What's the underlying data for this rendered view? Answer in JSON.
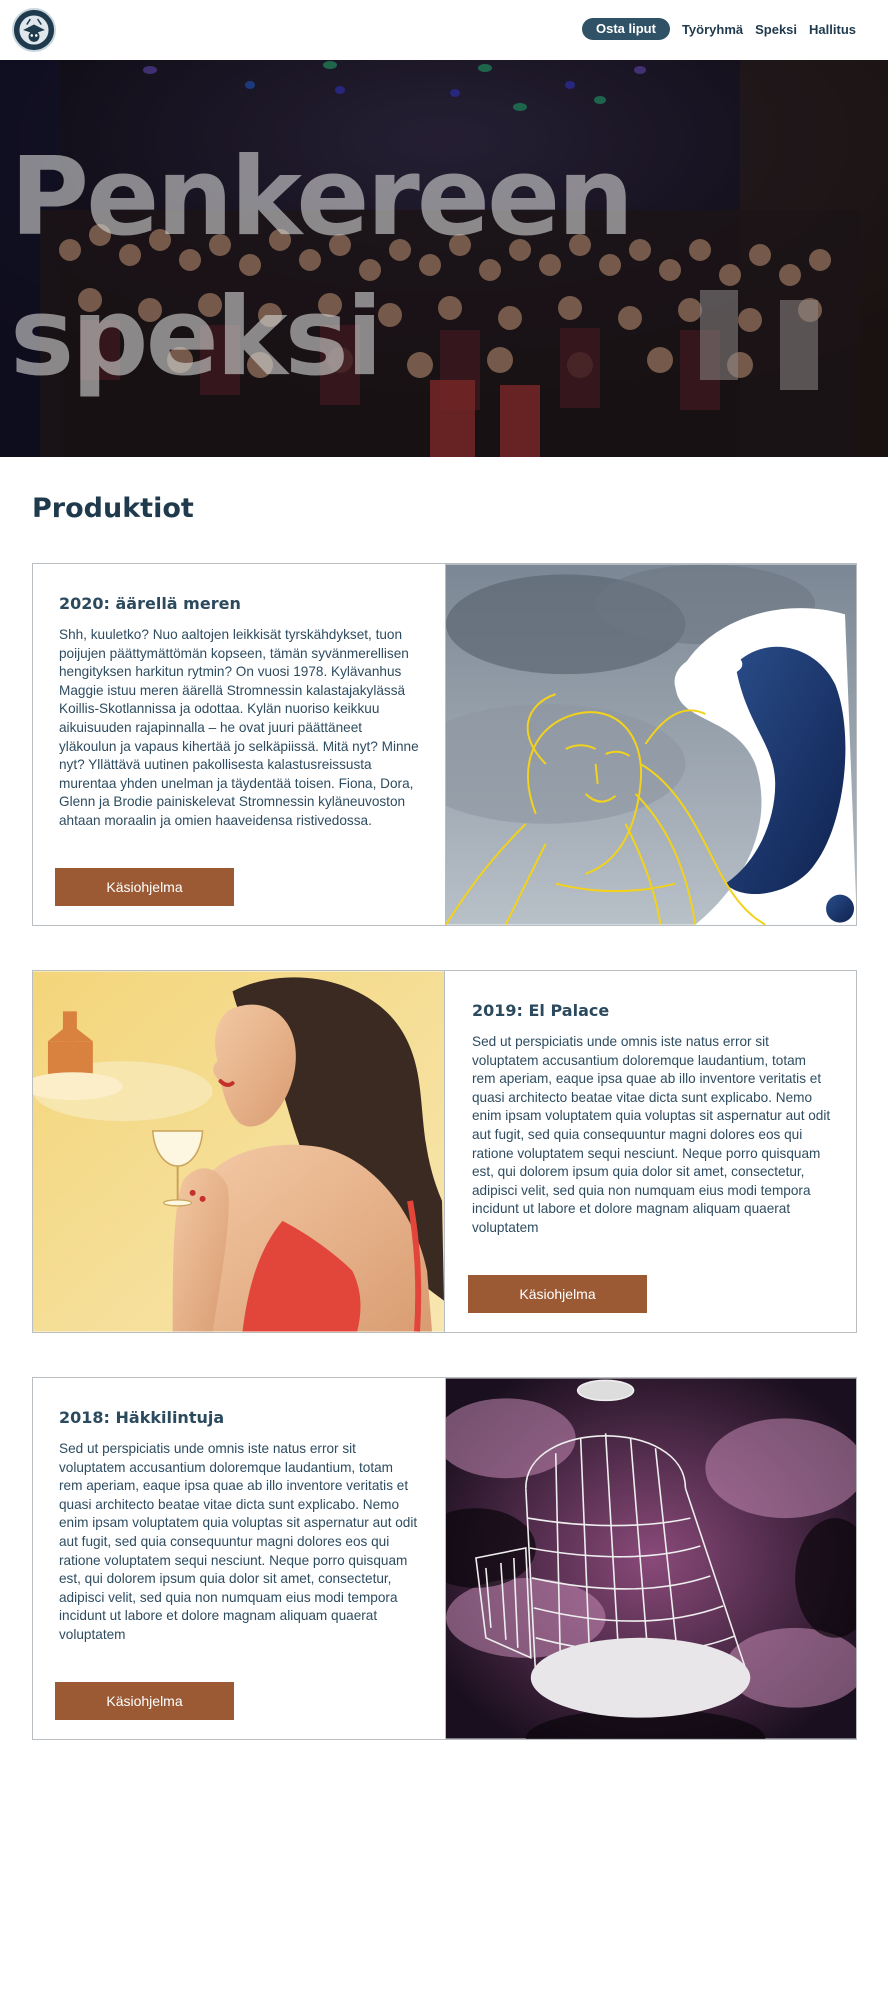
{
  "nav": {
    "logo_icon": "speksi-logo-icon",
    "cta_label": "Osta liput",
    "links": [
      "Työryhmä",
      "Speksi",
      "Hallitus"
    ]
  },
  "hero": {
    "title_line1": "Penkereen",
    "title_line2": "speksi"
  },
  "section": {
    "title": "Produktiot"
  },
  "productions": [
    {
      "title": "2020: äärellä meren",
      "body": "Shh, kuuletko? Nuo aaltojen leikkisät tyrskähdykset, tuon poijujen päättymättömän kopseen, tämän syvänmerellisen hengityksen harkitun rytmin? On vuosi 1978. Kylävanhus Maggie istuu meren äärellä Stromnessin kalastajakylässä Koillis-Skotlannissa ja odottaa. Kylän nuoriso keikkuu aikuisuuden rajapinnalla – he ovat juuri päättäneet yläkoulun ja vapaus kihertää jo selkäpiissä. Mitä nyt? Minne nyt? Yllättävä uutinen pakollisesta kalastusreissusta murentaa yhden unelman ja täydentää toisen. Fiona, Dora, Glenn ja Brodie painiskelevat Stromnessin kyläneuvoston ahtaan moraalin ja omien haaveidensa ristivedossa.",
      "button": "Käsiohjelma",
      "image_icon": "sea-woman-wave-illustration"
    },
    {
      "title": "2019: El Palace",
      "body": "Sed ut perspiciatis unde omnis iste natus error sit voluptatem accusantium doloremque laudantium, totam rem aperiam, eaque ipsa quae ab illo inventore veritatis et quasi architecto beatae vitae dicta sunt explicabo. Nemo enim ipsam voluptatem quia voluptas sit aspernatur aut odit aut fugit, sed quia consequuntur magni dolores eos qui ratione voluptatem sequi nesciunt. Neque porro quisquam est, qui dolorem ipsum quia dolor sit amet, consectetur, adipisci velit, sed quia non numquam eius modi tempora incidunt ut labore et dolore magnam aliquam quaerat voluptatem",
      "button": "Käsiohjelma",
      "image_icon": "woman-with-champagne-illustration"
    },
    {
      "title": "2018: Häkkilintuja",
      "body": "Sed ut perspiciatis unde omnis iste natus error sit voluptatem accusantium doloremque laudantium, totam rem aperiam, eaque ipsa quae ab illo inventore veritatis et quasi architecto beatae vitae dicta sunt explicabo. Nemo enim ipsam voluptatem quia voluptas sit aspernatur aut odit aut fugit, sed quia consequuntur magni dolores eos qui ratione voluptatem sequi nesciunt. Neque porro quisquam est, qui dolorem ipsum quia dolor sit amet, consectetur, adipisci velit, sed quia non numquam eius modi tempora incidunt ut labore et dolore magnam aliquam quaerat voluptatem",
      "button": "Käsiohjelma",
      "image_icon": "birdcage-in-clouds-illustration"
    }
  ],
  "colors": {
    "primary": "#1f3a4d",
    "cta": "#2f5266",
    "button": "#9b5a34"
  }
}
